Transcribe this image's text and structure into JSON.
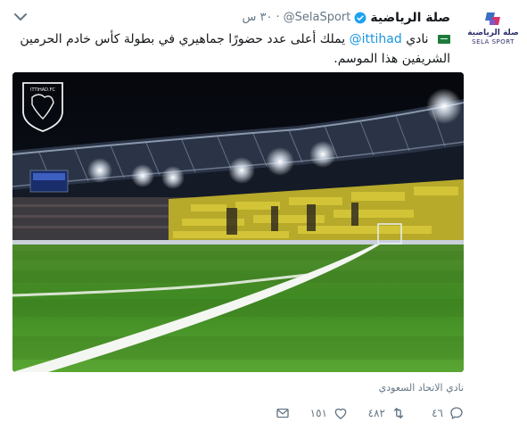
{
  "account": {
    "display_name": "صلة الرياضية",
    "handle": "@SelaSport",
    "time": "٣٠ س",
    "dot": "·",
    "avatar_text_ar": "صلة الرياضية",
    "avatar_text_en": "SELA SPORT"
  },
  "tweet": {
    "club_word": "نادي",
    "mention": "@ittihad",
    "body": "يملك أعلى عدد حضورًا جماهيري في بطولة كأس خادم الحرمين الشريفين هذا الموسم."
  },
  "media": {
    "logo_text": "ITTIHAD.FC",
    "caption": "نادي الاتحاد السعودي"
  },
  "actions": {
    "reply_count": "٤٦",
    "retweet_count": "٤٨٢",
    "like_count": "١٥١"
  },
  "colors": {
    "link": "#1b95e0",
    "muted": "#657786",
    "verified": "#1da1f2"
  },
  "icons": [
    "verified-icon",
    "caret-down-icon",
    "saudi-flag-icon",
    "reply-icon",
    "retweet-icon",
    "like-icon",
    "message-icon"
  ]
}
